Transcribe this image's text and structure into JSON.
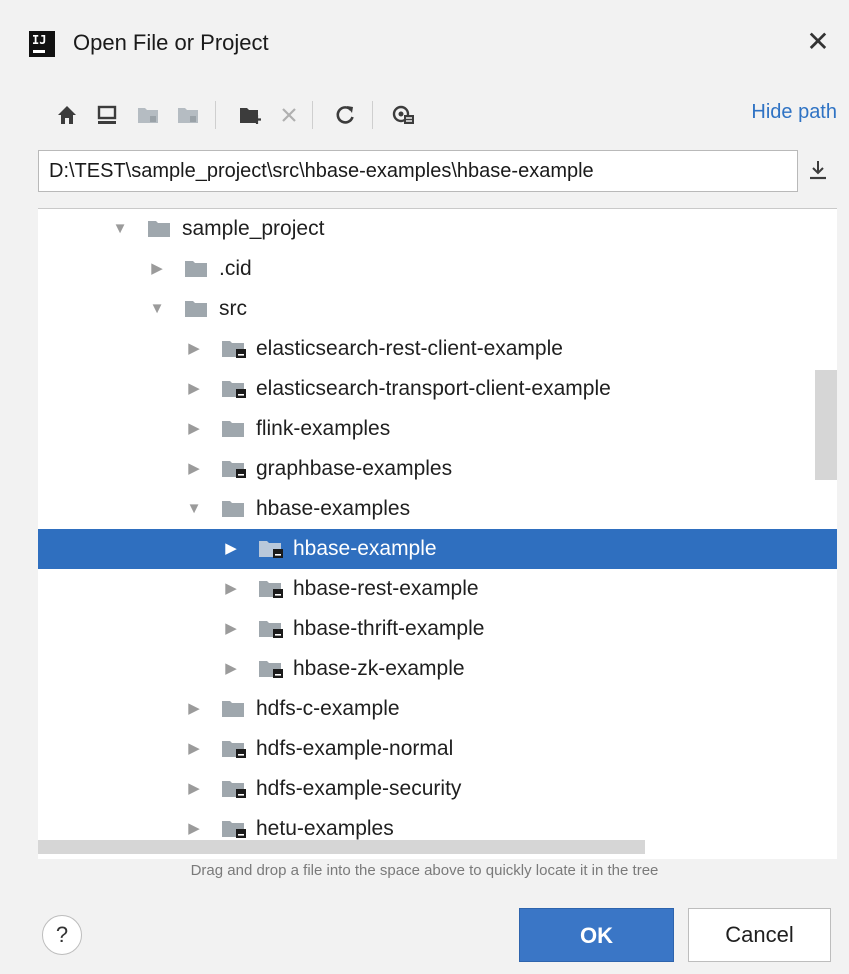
{
  "window": {
    "title": "Open File or Project",
    "close_glyph": "✕"
  },
  "toolbar": {
    "buttons": [
      {
        "icon": "home-icon"
      },
      {
        "icon": "desktop-icon"
      },
      {
        "icon": "project-folder-icon"
      },
      {
        "icon": "module-folder-icon"
      },
      {
        "icon": "new-folder-icon"
      },
      {
        "icon": "delete-icon"
      },
      {
        "icon": "refresh-icon"
      },
      {
        "icon": "show-hidden-icon"
      }
    ],
    "hide_path_label": "Hide path"
  },
  "path_field": {
    "value": "D:\\TEST\\sample_project\\src\\hbase-examples\\hbase-example"
  },
  "tree": {
    "rows": [
      {
        "label": "sample_project",
        "expanded": true,
        "module": false
      },
      {
        "label": ".cid",
        "expanded": false,
        "module": false
      },
      {
        "label": "src",
        "expanded": true,
        "module": false
      },
      {
        "label": "elasticsearch-rest-client-example",
        "expanded": false,
        "module": true
      },
      {
        "label": "elasticsearch-transport-client-example",
        "expanded": false,
        "module": true
      },
      {
        "label": "flink-examples",
        "expanded": false,
        "module": false
      },
      {
        "label": "graphbase-examples",
        "expanded": false,
        "module": true
      },
      {
        "label": "hbase-examples",
        "expanded": true,
        "module": false
      },
      {
        "label": "hbase-example",
        "expanded": false,
        "module": true,
        "selected": true
      },
      {
        "label": "hbase-rest-example",
        "expanded": false,
        "module": true
      },
      {
        "label": "hbase-thrift-example",
        "expanded": false,
        "module": true
      },
      {
        "label": "hbase-zk-example",
        "expanded": false,
        "module": true
      },
      {
        "label": "hdfs-c-example",
        "expanded": false,
        "module": false
      },
      {
        "label": "hdfs-example-normal",
        "expanded": false,
        "module": true
      },
      {
        "label": "hdfs-example-security",
        "expanded": false,
        "module": true
      },
      {
        "label": "hetu-examples",
        "expanded": false,
        "module": true
      }
    ]
  },
  "hint": "Drag and drop a file into the space above to quickly locate it in the tree",
  "footer": {
    "help_label": "?",
    "ok_label": "OK",
    "cancel_label": "Cancel"
  },
  "colors": {
    "accent": "#2f6fbf",
    "link": "#2f73c4",
    "folder": "#9fa7ad"
  }
}
